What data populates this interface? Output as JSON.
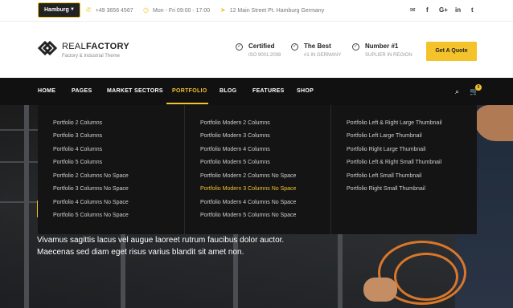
{
  "topbar": {
    "city": "Hamburg",
    "phone": "+49 3656 4567",
    "hours": "Mon - Fri 09:00 - 17:00",
    "address": "12 Main Street Pt. Hamburg Germany",
    "social": [
      "✉",
      "f",
      "G+",
      "in",
      "t"
    ]
  },
  "header": {
    "logo_bold": "REAL",
    "logo_light": "FACTORY",
    "tagline": "Factory & Industrial Theme",
    "info": [
      {
        "title": "Certified",
        "sub": "ISO 9001:2008"
      },
      {
        "title": "The Best",
        "sub": "#1 IN GERMANY"
      },
      {
        "title": "Number #1",
        "sub": "SUPLIER IN REGION"
      }
    ],
    "quote_label": "Get A Quote"
  },
  "nav": {
    "items": [
      "HOME",
      "PAGES",
      "MARKET SECTORS",
      "PORTFOLIO",
      "BLOG",
      "FEATURES",
      "SHOP"
    ],
    "active": "PORTFOLIO",
    "cart_count": "0"
  },
  "mega_menu": {
    "col1": [
      "Portfolio 2 Columns",
      "Portfolio 3 Columns",
      "Portfolio 4 Columns",
      "Portfolio 5 Columns",
      "Portfolio 2 Columns No Space",
      "Portfolio 3 Columns No Space",
      "Portfolio 4 Columns No Space",
      "Portfolio 5 Columns No Space"
    ],
    "col2": [
      "Portfolio Modern 2 Columns",
      "Portfolio Modern 3 Columns",
      "Portfolio Modern 4 Columns",
      "Portfolio Modern 5 Columns",
      "Portfolio Modern 2 Columns No Space",
      "Portfolio Modern 3 Columns No Space",
      "Portfolio Modern 4 Columns No Space",
      "Portfolio Modern 5 Columns No Space"
    ],
    "col3": [
      "Portfolio Left & Right Large Thumbnail",
      "Portfolio Left Large Thumbnail",
      "Portfolio Right Large Thumbnail",
      "Portfolio Left & Right Small Thumbnail",
      "Portfolio Left Small Thumbnail",
      "Portfolio Right Small Thumbnail"
    ],
    "active_item": "Portfolio Modern 3 Columns No Space"
  },
  "hero": {
    "line1": "Vivamus sagittis lacus vel augue laoreet rutrum faucibus dolor auctor.",
    "line2": "Maecenas sed diam eget risus varius blandit sit amet non."
  },
  "colors": {
    "accent": "#f4c22b",
    "nav_bg": "#111111",
    "menu_bg": "#141414"
  }
}
